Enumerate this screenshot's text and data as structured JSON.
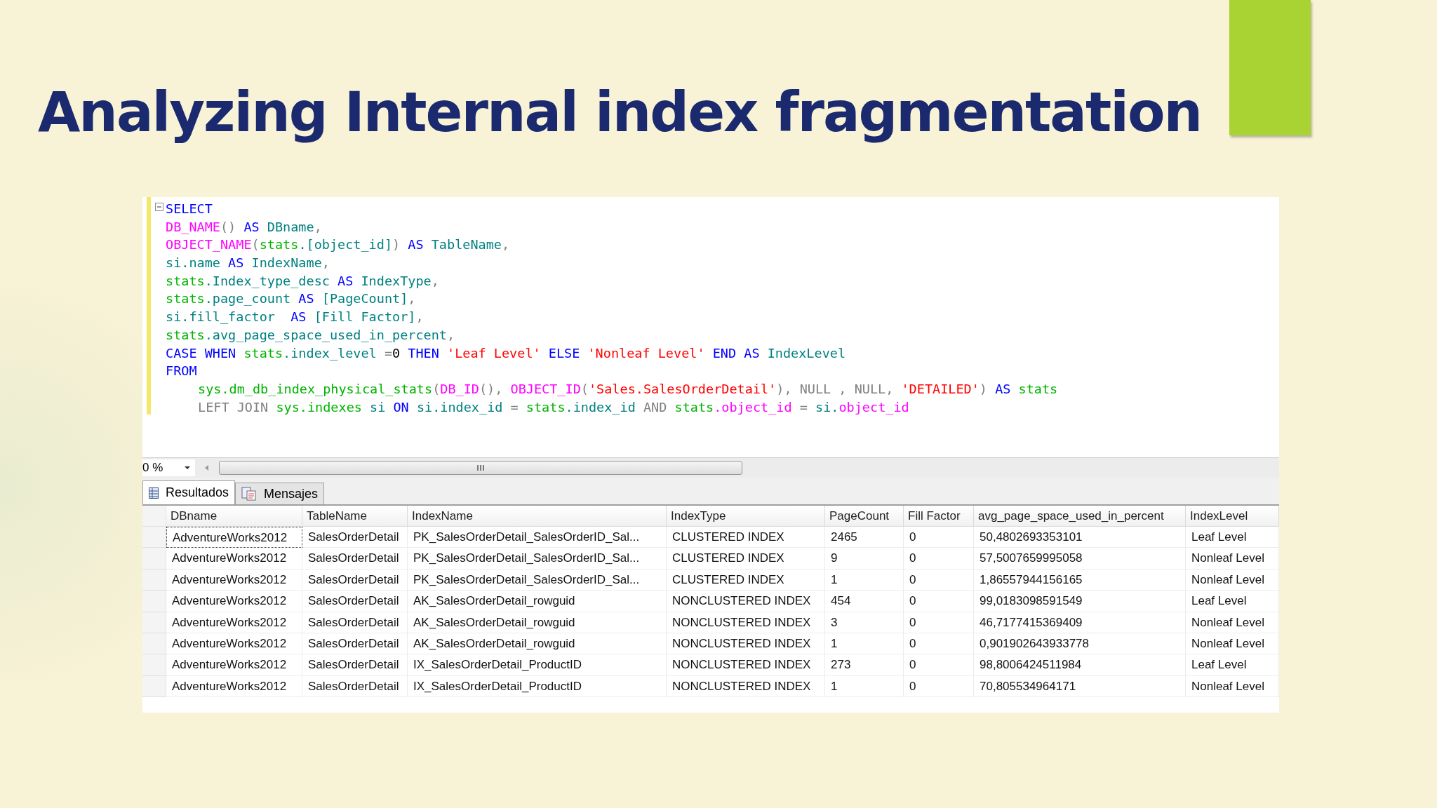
{
  "slide": {
    "title": "Analyzing Internal index fragmentation"
  },
  "editor": {
    "lines": [
      {
        "indented": false,
        "tokens": [
          {
            "kind": "keyword",
            "text": "SELECT"
          }
        ]
      },
      {
        "indented": false,
        "tokens": [
          {
            "kind": "function",
            "text": "DB_NAME"
          },
          {
            "kind": "gray",
            "text": "()"
          },
          {
            "kind": "keyword",
            "text": " AS "
          },
          {
            "kind": "identifier",
            "text": "DBname"
          },
          {
            "kind": "gray",
            "text": ","
          }
        ]
      },
      {
        "indented": false,
        "tokens": [
          {
            "kind": "function",
            "text": "OBJECT_NAME"
          },
          {
            "kind": "gray",
            "text": "("
          },
          {
            "kind": "system",
            "text": "stats"
          },
          {
            "kind": "identifier",
            "text": ".[object_id]"
          },
          {
            "kind": "gray",
            "text": ")"
          },
          {
            "kind": "keyword",
            "text": " AS "
          },
          {
            "kind": "identifier",
            "text": "TableName"
          },
          {
            "kind": "gray",
            "text": ","
          }
        ]
      },
      {
        "indented": false,
        "tokens": [
          {
            "kind": "identifier",
            "text": "si.name"
          },
          {
            "kind": "keyword",
            "text": " AS "
          },
          {
            "kind": "identifier",
            "text": "IndexName"
          },
          {
            "kind": "gray",
            "text": ","
          }
        ]
      },
      {
        "indented": false,
        "tokens": [
          {
            "kind": "system",
            "text": "stats"
          },
          {
            "kind": "identifier",
            "text": ".Index_type_desc"
          },
          {
            "kind": "keyword",
            "text": " AS "
          },
          {
            "kind": "identifier",
            "text": "IndexType"
          },
          {
            "kind": "gray",
            "text": ","
          }
        ]
      },
      {
        "indented": false,
        "tokens": [
          {
            "kind": "system",
            "text": "stats"
          },
          {
            "kind": "identifier",
            "text": ".page_count"
          },
          {
            "kind": "keyword",
            "text": " AS "
          },
          {
            "kind": "identifier",
            "text": "[PageCount]"
          },
          {
            "kind": "gray",
            "text": ","
          }
        ]
      },
      {
        "indented": false,
        "tokens": [
          {
            "kind": "identifier",
            "text": "si.fill_factor"
          },
          {
            "kind": "keyword",
            "text": "  AS "
          },
          {
            "kind": "identifier",
            "text": "[Fill Factor]"
          },
          {
            "kind": "gray",
            "text": ","
          }
        ]
      },
      {
        "indented": false,
        "tokens": [
          {
            "kind": "system",
            "text": "stats"
          },
          {
            "kind": "identifier",
            "text": ".avg_page_space_used_in_percent"
          },
          {
            "kind": "gray",
            "text": ","
          }
        ]
      },
      {
        "indented": false,
        "tokens": [
          {
            "kind": "keyword",
            "text": "CASE WHEN "
          },
          {
            "kind": "system",
            "text": "stats"
          },
          {
            "kind": "identifier",
            "text": ".index_level "
          },
          {
            "kind": "gray",
            "text": "="
          },
          {
            "kind": "plain",
            "text": "0"
          },
          {
            "kind": "keyword",
            "text": " THEN "
          },
          {
            "kind": "string",
            "text": "'Leaf Level'"
          },
          {
            "kind": "keyword",
            "text": " ELSE "
          },
          {
            "kind": "string",
            "text": "'Nonleaf Level'"
          },
          {
            "kind": "keyword",
            "text": " END AS "
          },
          {
            "kind": "identifier",
            "text": "IndexLevel"
          }
        ]
      },
      {
        "indented": false,
        "tokens": [
          {
            "kind": "keyword",
            "text": "FROM"
          }
        ]
      },
      {
        "indented": true,
        "tokens": [
          {
            "kind": "system",
            "text": "sys.dm_db_index_physical_stats"
          },
          {
            "kind": "gray",
            "text": "("
          },
          {
            "kind": "function",
            "text": "DB_ID"
          },
          {
            "kind": "gray",
            "text": "(), "
          },
          {
            "kind": "function",
            "text": "OBJECT_ID"
          },
          {
            "kind": "gray",
            "text": "("
          },
          {
            "kind": "string",
            "text": "'Sales.SalesOrderDetail'"
          },
          {
            "kind": "gray",
            "text": "), NULL , NULL, "
          },
          {
            "kind": "string",
            "text": "'DETAILED'"
          },
          {
            "kind": "gray",
            "text": ") "
          },
          {
            "kind": "keyword",
            "text": "AS "
          },
          {
            "kind": "system",
            "text": "stats"
          }
        ]
      },
      {
        "indented": true,
        "tokens": [
          {
            "kind": "gray",
            "text": "LEFT JOIN "
          },
          {
            "kind": "system",
            "text": "sys.indexes"
          },
          {
            "kind": "identifier",
            "text": " si "
          },
          {
            "kind": "keyword",
            "text": "ON "
          },
          {
            "kind": "identifier",
            "text": "si.index_id "
          },
          {
            "kind": "gray",
            "text": "= "
          },
          {
            "kind": "system",
            "text": "stats"
          },
          {
            "kind": "identifier",
            "text": ".index_id "
          },
          {
            "kind": "gray",
            "text": "AND "
          },
          {
            "kind": "system",
            "text": "stats"
          },
          {
            "kind": "function",
            "text": ".object_id "
          },
          {
            "kind": "gray",
            "text": "= "
          },
          {
            "kind": "identifier",
            "text": "si."
          },
          {
            "kind": "function",
            "text": "object_id"
          }
        ]
      }
    ]
  },
  "zoom": "0 %",
  "tabs": [
    {
      "label": "Resultados",
      "selected": true
    },
    {
      "label": "Mensajes",
      "selected": false
    }
  ],
  "table": {
    "columns": [
      "DBname",
      "TableName",
      "IndexName",
      "IndexType",
      "PageCount",
      "Fill Factor",
      "avg_page_space_used_in_percent",
      "IndexLevel"
    ],
    "rows": [
      {
        "selected": true,
        "cells": [
          "AdventureWorks2012",
          "SalesOrderDetail",
          "PK_SalesOrderDetail_SalesOrderID_Sal...",
          "CLUSTERED INDEX",
          "2465",
          "0",
          "50,4802693353101",
          "Leaf Level"
        ]
      },
      {
        "selected": false,
        "cells": [
          "AdventureWorks2012",
          "SalesOrderDetail",
          "PK_SalesOrderDetail_SalesOrderID_Sal...",
          "CLUSTERED INDEX",
          "9",
          "0",
          "57,5007659995058",
          "Nonleaf Level"
        ]
      },
      {
        "selected": false,
        "cells": [
          "AdventureWorks2012",
          "SalesOrderDetail",
          "PK_SalesOrderDetail_SalesOrderID_Sal...",
          "CLUSTERED INDEX",
          "1",
          "0",
          "1,86557944156165",
          "Nonleaf Level"
        ]
      },
      {
        "selected": false,
        "cells": [
          "AdventureWorks2012",
          "SalesOrderDetail",
          "AK_SalesOrderDetail_rowguid",
          "NONCLUSTERED INDEX",
          "454",
          "0",
          "99,0183098591549",
          "Leaf Level"
        ]
      },
      {
        "selected": false,
        "cells": [
          "AdventureWorks2012",
          "SalesOrderDetail",
          "AK_SalesOrderDetail_rowguid",
          "NONCLUSTERED INDEX",
          "3",
          "0",
          "46,7177415369409",
          "Nonleaf Level"
        ]
      },
      {
        "selected": false,
        "cells": [
          "AdventureWorks2012",
          "SalesOrderDetail",
          "AK_SalesOrderDetail_rowguid",
          "NONCLUSTERED INDEX",
          "1",
          "0",
          "0,901902643933778",
          "Nonleaf Level"
        ]
      },
      {
        "selected": false,
        "cells": [
          "AdventureWorks2012",
          "SalesOrderDetail",
          "IX_SalesOrderDetail_ProductID",
          "NONCLUSTERED INDEX",
          "273",
          "0",
          "98,8006424511984",
          "Leaf Level"
        ]
      },
      {
        "selected": false,
        "cells": [
          "AdventureWorks2012",
          "SalesOrderDetail",
          "IX_SalesOrderDetail_ProductID",
          "NONCLUSTERED INDEX",
          "1",
          "0",
          "70,805534964171",
          "Nonleaf Level"
        ]
      }
    ]
  }
}
